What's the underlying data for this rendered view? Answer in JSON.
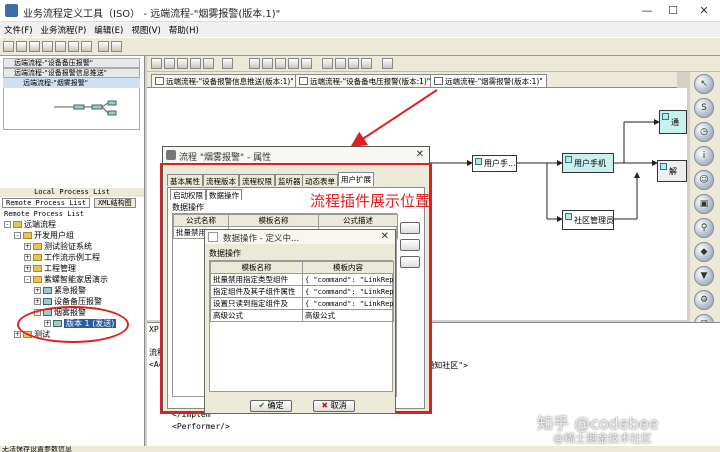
{
  "window": {
    "title": "业务流程定义工具（ISO） - 远端流程-\"烟雾报警(版本.1)\"",
    "min": "—",
    "max": "☐",
    "close": "✕"
  },
  "menu": [
    "文件(F)",
    "业务流程(P)",
    "编辑(E)",
    "视图(V)",
    "帮助(H)"
  ],
  "left_panel": {
    "thumb_tabs": [
      "远端流程-\"设备备压报警\"",
      "远端流程-\"设备报警信息推送\""
    ],
    "thumb_selected": "远端流程-\"烟雾报警\"",
    "local_title": "Local Process List",
    "tabs": [
      "Remote Process List",
      "XML结构图"
    ],
    "remote_title": "Remote Process List",
    "tree": [
      "远端流程",
      "开发用户组",
      "测试验证系统",
      "工作流示例工程",
      "工程管理",
      "紫螺智能家居演示",
      "紧急报警",
      "设备备压报警",
      "烟雾报警",
      "版本 1",
      "(发送)",
      "测试"
    ]
  },
  "doc_tabs": [
    "远端流程-\"设备报警信息推送(版本:1)\"",
    "远端流程-\"设备备电压报警(版本:1)\"",
    "远端流程-\"烟雾报警(版本:1)\""
  ],
  "canvas": {
    "nodes": {
      "user_phone_a": "用户手...",
      "user_phone_b": "用户手机",
      "community_admin": "社区管理员",
      "right_a": "通",
      "right_b": "解"
    }
  },
  "code": {
    "prefix": "XP",
    "line1": "<Ac",
    "line2": "me=\"通知社区\">",
    "line3": "</Implem",
    "line4": "<Performer/>",
    "label1": "流程",
    "label2": "<Ac"
  },
  "dialog": {
    "title": "流程 \"烟雾报警\" - 属性",
    "close": "✕",
    "tabs": [
      "基本属性",
      "流程版本",
      "流程权限",
      "监听器",
      "动态表单",
      "用户扩展"
    ],
    "subtabs": [
      "启动权限",
      "数据操作"
    ],
    "group_label": "数据操作",
    "headers": [
      "公式名称",
      "模板名称",
      "公式描述"
    ],
    "row": [
      "批量禁用"
    ]
  },
  "annotation": "流程插件展示位置",
  "inner_dialog": {
    "title": "数据操作 - 定义中...",
    "close": "✕",
    "group_label": "数据操作",
    "headers": [
      "模板名称",
      "模板内容"
    ],
    "rows": [
      [
        "批量禁用指定类型组件",
        "{ \"command\": \"LinkRepo..."
      ],
      [
        "指定组件及其子组件属性",
        "{ \"command\": \"LinkRepo..."
      ],
      [
        "设置只读到指定组件及",
        "{ \"command\": \"LinkRepo..."
      ],
      [
        "高级公式",
        "高级公式"
      ]
    ],
    "ok": "确定",
    "cancel": "取消"
  },
  "status": "无法保存设置参数信息",
  "watermark": "知乎 @codebee",
  "watermark2": "@稀土掘金技术社区"
}
